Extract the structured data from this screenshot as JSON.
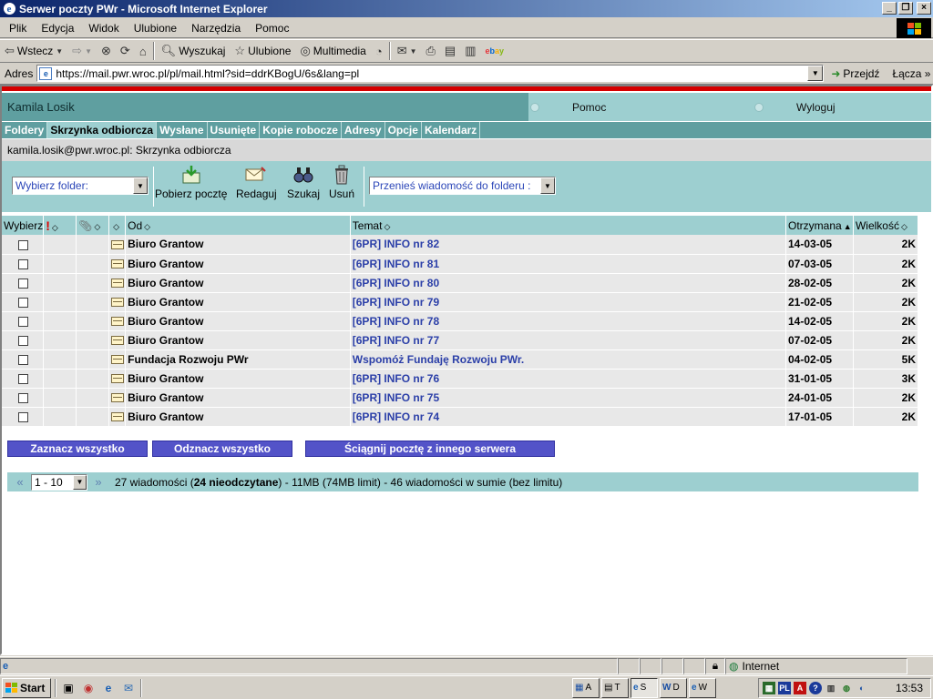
{
  "window": {
    "title": "Serwer poczty PWr - Microsoft Internet Explorer",
    "controls": [
      "_",
      "❐",
      "×"
    ]
  },
  "menu": [
    "Plik",
    "Edycja",
    "Widok",
    "Ulubione",
    "Narzędzia",
    "Pomoc"
  ],
  "toolbar": {
    "back": "Wstecz",
    "search": "Wyszukaj",
    "favorites": "Ulubione",
    "media": "Multimedia"
  },
  "address": {
    "label": "Adres",
    "url": "https://mail.pwr.wroc.pl/pl/mail.html?sid=ddrKBogU/6s&lang=pl",
    "go": "Przejdź",
    "links": "Łącza"
  },
  "page": {
    "user_name": "Kamila Losik",
    "help": "Pomoc",
    "logout": "Wyloguj",
    "tabs": [
      "Foldery",
      "Skrzynka odbiorcza",
      "Wysłane",
      "Usunięte",
      "Kopie robocze",
      "Adresy",
      "Opcje",
      "Kalendarz"
    ],
    "active_tab": "Skrzynka odbiorcza",
    "path": "kamila.losik@pwr.wroc.pl: Skrzynka odbiorcza",
    "folder_select": "Wybierz folder:",
    "actions": {
      "fetch": "Pobierz pocztę",
      "compose": "Redaguj",
      "search": "Szukaj",
      "delete": "Usuń"
    },
    "move_select": "Przenieś wiadomość do folderu :",
    "columns": {
      "select": "Wybierz",
      "from": "Od",
      "subject": "Temat",
      "received": "Otrzymana",
      "size": "Wielkość"
    },
    "messages": [
      {
        "from": "Biuro Grantow",
        "subject": "[6PR] INFO nr 82",
        "date": "14-03-05",
        "size": "2K"
      },
      {
        "from": "Biuro Grantow",
        "subject": "[6PR] INFO nr 81",
        "date": "07-03-05",
        "size": "2K"
      },
      {
        "from": "Biuro Grantow",
        "subject": "[6PR] INFO nr 80",
        "date": "28-02-05",
        "size": "2K"
      },
      {
        "from": "Biuro Grantow",
        "subject": "[6PR] INFO nr 79",
        "date": "21-02-05",
        "size": "2K"
      },
      {
        "from": "Biuro Grantow",
        "subject": "[6PR] INFO nr 78",
        "date": "14-02-05",
        "size": "2K"
      },
      {
        "from": "Biuro Grantow",
        "subject": "[6PR] INFO nr 77",
        "date": "07-02-05",
        "size": "2K"
      },
      {
        "from": "Fundacja Rozwoju PWr",
        "subject": "Wspomóż Fundaję Rozwoju PWr.",
        "date": "04-02-05",
        "size": "5K"
      },
      {
        "from": "Biuro Grantow",
        "subject": "[6PR] INFO nr 76",
        "date": "31-01-05",
        "size": "3K"
      },
      {
        "from": "Biuro Grantow",
        "subject": "[6PR] INFO nr 75",
        "date": "24-01-05",
        "size": "2K"
      },
      {
        "from": "Biuro Grantow",
        "subject": "[6PR] INFO nr 74",
        "date": "17-01-05",
        "size": "2K"
      }
    ],
    "buttons": {
      "select_all": "Zaznacz wszystko",
      "deselect_all": "Odznacz wszystko",
      "fetch_other": "Ściągnij pocztę z innego serwera"
    },
    "pager": {
      "range": "1 - 10",
      "count": "27 wiadomości (",
      "unread": "24 nieodczytane",
      "rest": ") - 11MB (74MB limit) - 46 wiadomości w sumie (bez limitu)"
    }
  },
  "status": {
    "zone": "Internet"
  },
  "taskbar": {
    "start": "Start",
    "tasks": [
      "A",
      "T",
      "S",
      "D",
      "W"
    ],
    "tray_badge": "PL",
    "clock": "13:53"
  }
}
